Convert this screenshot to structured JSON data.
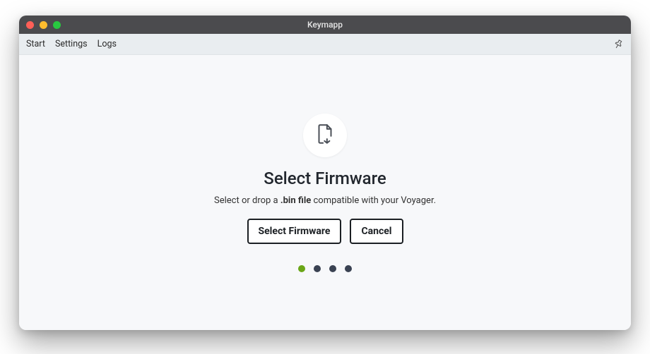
{
  "titlebar": {
    "title": "Keymapp"
  },
  "menubar": {
    "items": [
      "Start",
      "Settings",
      "Logs"
    ]
  },
  "main": {
    "heading": "Select Firmware",
    "sub_pre": "Select or drop a ",
    "sub_bold": ".bin file",
    "sub_post": " compatible with your Voyager.",
    "select_btn": "Select Firmware",
    "cancel_btn": "Cancel"
  },
  "stepper": {
    "total": 4,
    "active_index": 0
  },
  "colors": {
    "dot_active": "#6aa617",
    "dot_inactive": "#3a4252"
  }
}
